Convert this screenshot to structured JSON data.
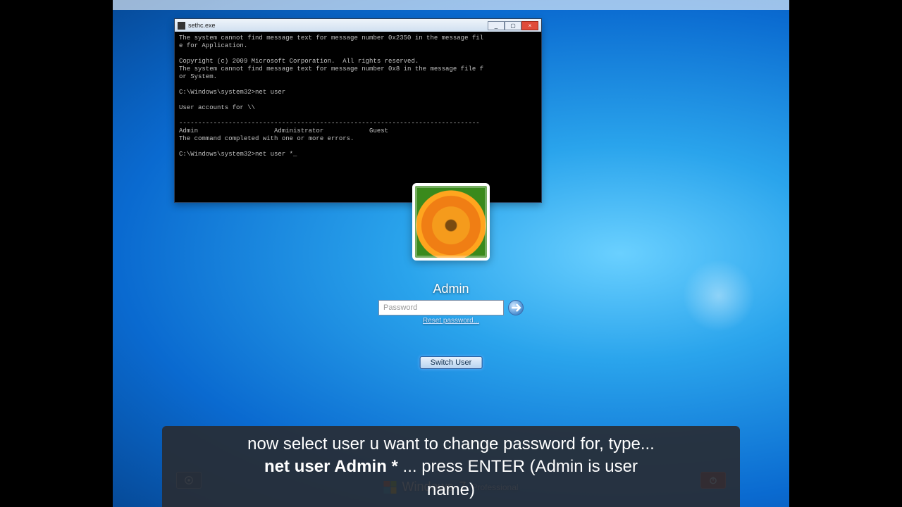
{
  "cmd": {
    "title": "sethc.exe",
    "lines": [
      "The system cannot find message text for message number 0x2350 in the message fil",
      "e for Application.",
      "",
      "Copyright (c) 2009 Microsoft Corporation.  All rights reserved.",
      "The system cannot find message text for message number 0x8 in the message file f",
      "or System.",
      "",
      "C:\\Windows\\system32>net user",
      "",
      "User accounts for \\\\",
      "",
      "-------------------------------------------------------------------------------",
      "Admin                    Administrator            Guest",
      "The command completed with one or more errors.",
      "",
      "C:\\Windows\\system32>net user *_"
    ],
    "min": "_",
    "max": "▢",
    "close": "×"
  },
  "login": {
    "username": "Admin",
    "pw_placeholder": "Password",
    "reset": "Reset password...",
    "switch": "Switch User"
  },
  "brand": {
    "text": "Windows",
    "ver": "7",
    "edition": "Professional"
  },
  "caption": {
    "l1": "now select user u want to change password for, type...",
    "l2a": "net user Admin *",
    "l2b": " ... press ENTER (Admin is user",
    "l3": "name)"
  }
}
